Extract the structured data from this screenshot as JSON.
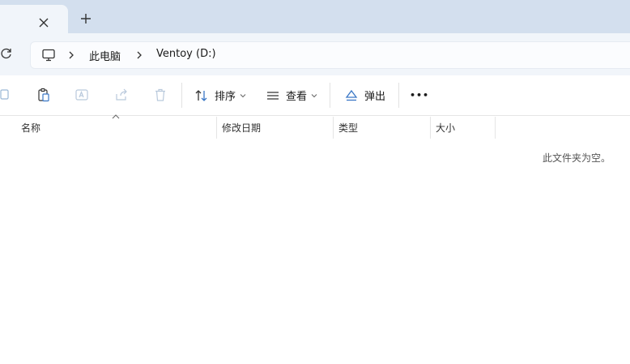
{
  "tab": {
    "close_icon": "close-icon",
    "add_icon": "plus-icon"
  },
  "breadcrumb": {
    "items": [
      "此电脑",
      "Ventoy (D:)"
    ]
  },
  "toolbar": {
    "sort_label": "排序",
    "view_label": "查看",
    "eject_label": "弹出",
    "more_label": "•••"
  },
  "columns": [
    "名称",
    "修改日期",
    "类型",
    "大小"
  ],
  "empty_message": "此文件夹为空。",
  "colors": {
    "tabstrip": "#d3dfee",
    "navbar": "#f1f5fa",
    "accent": "#0a5fb4"
  }
}
